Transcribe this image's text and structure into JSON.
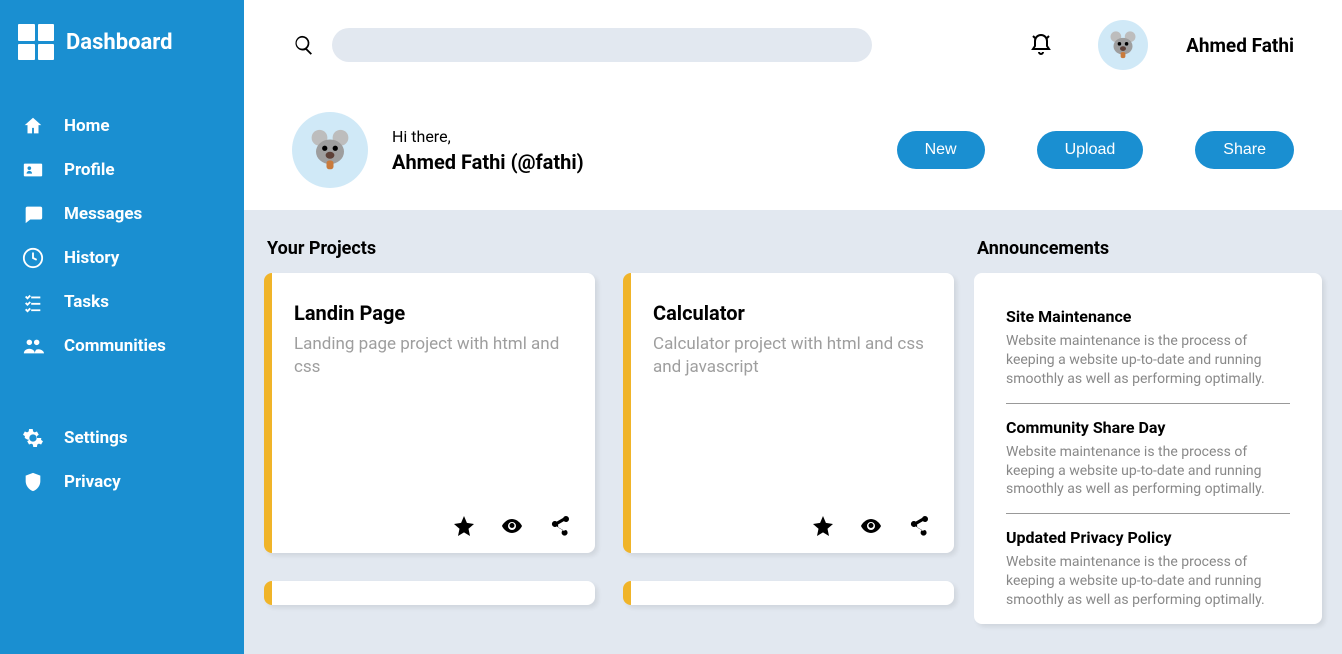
{
  "brand": {
    "title": "Dashboard"
  },
  "sidebar": {
    "main": [
      {
        "label": "Home",
        "icon": "home"
      },
      {
        "label": "Profile",
        "icon": "card"
      },
      {
        "label": "Messages",
        "icon": "message"
      },
      {
        "label": "History",
        "icon": "clock"
      },
      {
        "label": "Tasks",
        "icon": "tasks"
      },
      {
        "label": " Communities",
        "icon": "people"
      }
    ],
    "secondary": [
      {
        "label": "Settings",
        "icon": "gear"
      },
      {
        "label": "Privacy",
        "icon": "shield"
      }
    ]
  },
  "topbar": {
    "search_placeholder": "",
    "user_name": "Ahmed Fathi"
  },
  "userbar": {
    "greeting": "Hi there,",
    "fullname": "Ahmed Fathi (@fathi)",
    "actions": {
      "new": "New",
      "upload": "Upload",
      "share": "Share"
    }
  },
  "projects": {
    "heading": "Your Projects",
    "items": [
      {
        "title": "Landin Page",
        "desc": "Landing page project with html and css"
      },
      {
        "title": "Calculator",
        "desc": "Calculator project with html and css and javascript"
      }
    ]
  },
  "announcements": {
    "heading": "Announcements",
    "items": [
      {
        "title": "Site Maintenance",
        "text": "Website maintenance is the process of keeping a website up-to-date and running smoothly as well as performing optimally."
      },
      {
        "title": "Community Share Day",
        "text": "Website maintenance is the process of keeping a website up-to-date and running smoothly as well as performing optimally."
      },
      {
        "title": "Updated Privacy Policy",
        "text": "Website maintenance is the process of keeping a website up-to-date and running smoothly as well as performing optimally."
      }
    ]
  }
}
